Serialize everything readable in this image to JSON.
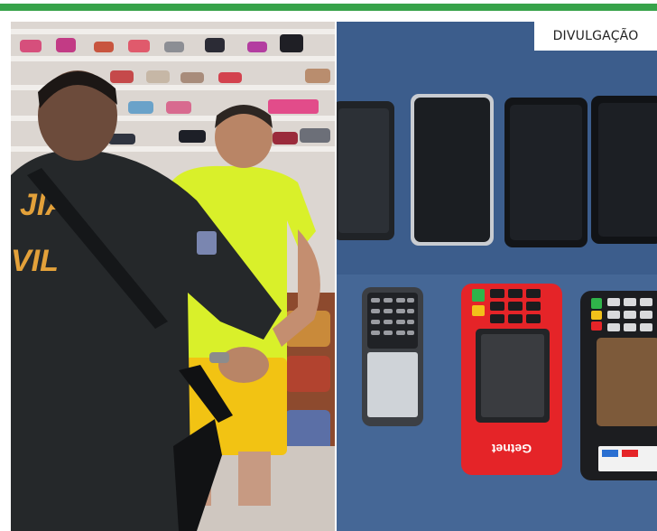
{
  "credit": {
    "label": "DIVULGAÇÃO"
  },
  "left_photo": {
    "vest_text_line1": "JIA",
    "vest_text_line2": "VIL"
  },
  "right_photo": {
    "terminal_brand": "Getnet"
  },
  "colors": {
    "accent_green": "#37a34a",
    "table_blue": "#3d5f8e",
    "terminal_red": "#e52428",
    "shirt_yellow": "#d9f02a"
  }
}
